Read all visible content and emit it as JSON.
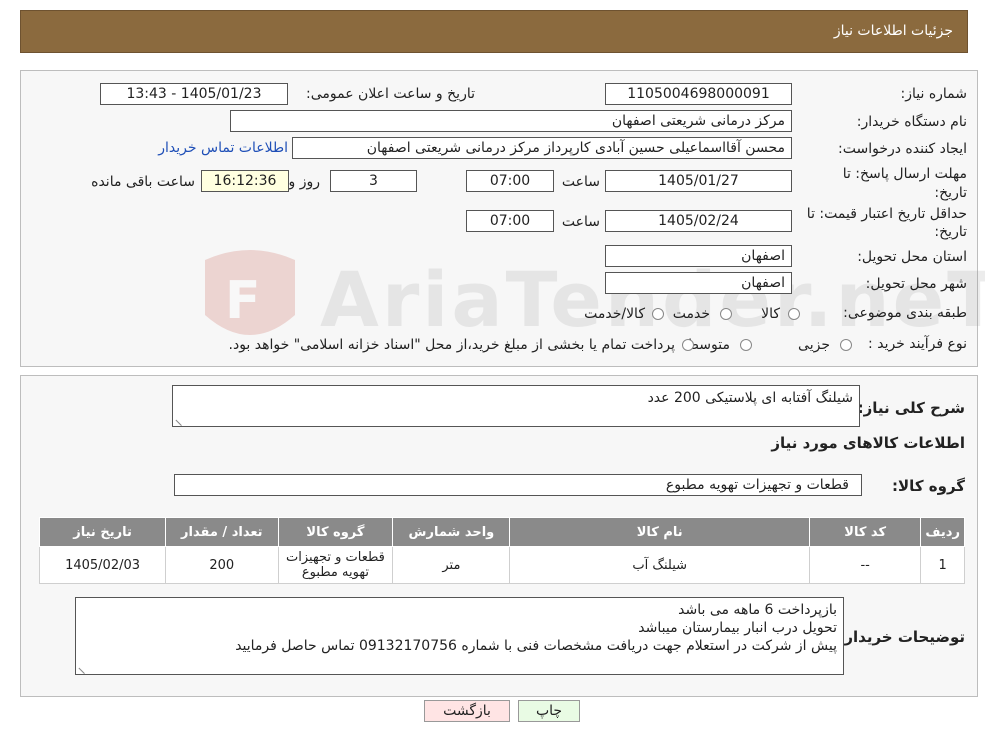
{
  "header": {
    "title": "جزئیات اطلاعات نیاز"
  },
  "fields": {
    "need_number_label": "شماره نیاز:",
    "need_number": "1105004698000091",
    "announce_label": "تاریخ و ساعت اعلان عمومی:",
    "announce_value": "1405/01/23 - 13:43",
    "buyer_org_label": "نام دستگاه خریدار:",
    "buyer_org": "مرکز درمانی شریعتی اصفهان",
    "creator_label": "ایجاد کننده درخواست:",
    "creator": "محسن آقااسماعیلی حسین آبادی کارپرداز مرکز درمانی شریعتی اصفهان",
    "contact_link": "اطلاعات تماس خریدار",
    "deadline_label_1": "مهلت ارسال پاسخ: تا",
    "deadline_label_2": "تاریخ:",
    "deadline_date": "1405/01/27",
    "time_label": "ساعت",
    "deadline_time": "07:00",
    "days_value": "3",
    "days_label": "روز و",
    "remaining_time": "16:12:36",
    "remaining_label": "ساعت باقی مانده",
    "validity_label_1": "حداقل تاریخ اعتبار قیمت: تا",
    "validity_label_2": "تاریخ:",
    "validity_date": "1405/02/24",
    "validity_time_label": "ساعت",
    "validity_time": "07:00",
    "province_label": "استان محل تحویل:",
    "province": "اصفهان",
    "city_label": "شهر محل تحویل:",
    "city": "اصفهان",
    "category_label": "طبقه بندی موضوعی:",
    "category_options": [
      "کالا",
      "خدمت",
      "کالا/خدمت"
    ],
    "process_label": "نوع فرآیند خرید :",
    "process_options": [
      "جزیی",
      "متوسط"
    ],
    "process_note": "پرداخت تمام یا بخشی از مبلغ خرید،از محل \"اسناد خزانه اسلامی\" خواهد بود."
  },
  "summary": {
    "general_desc_label": "شرح کلی نیاز:",
    "general_desc": "شیلنگ آفتابه ای پلاستیکی 200 عدد",
    "goods_info_title": "اطلاعات کالاهای مورد نیاز",
    "goods_group_label": "گروه کالا:",
    "goods_group": "قطعات و تجهیزات تهویه مطبوع"
  },
  "table": {
    "headers": [
      "ردیف",
      "کد کالا",
      "نام کالا",
      "واحد شمارش",
      "گروه کالا",
      "تعداد / مقدار",
      "تاریخ نیاز"
    ],
    "rows": [
      [
        "1",
        "--",
        "شیلنگ آب",
        "متر",
        "قطعات و تجهیزات تهویه مطبوع",
        "200",
        "1405/02/03"
      ]
    ]
  },
  "buyer_notes": {
    "label": "توضیحات خریدار:",
    "lines": [
      "بازپرداخت 6 ماهه می باشد",
      "تحویل درب انبار بیمارستان میباشد",
      "پیش از شرکت در استعلام جهت دریافت مشخصات فنی با شماره 09132170756 تماس حاصل فرمایید"
    ]
  },
  "buttons": {
    "print": "چاپ",
    "back": "بازگشت"
  },
  "watermark": {
    "text": "AriaTender.neT"
  },
  "colors": {
    "header_bg": "#8b6a3e",
    "table_header_bg": "#8a8a8a",
    "back_btn_bg": "#ffe4e4",
    "print_btn_bg": "#e9fbe4"
  }
}
